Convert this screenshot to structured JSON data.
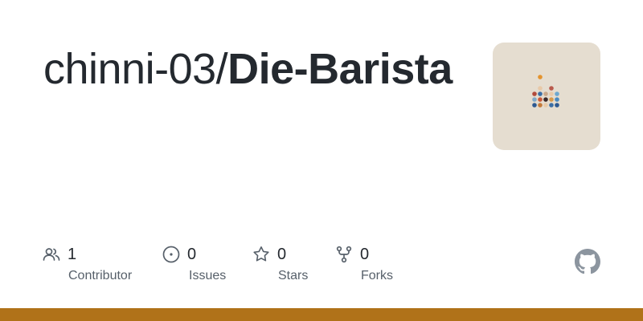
{
  "repo": {
    "owner": "chinni-03/",
    "name": "Die-Barista"
  },
  "stats": [
    {
      "value": "1",
      "label": "Contributor",
      "icon": "people-icon"
    },
    {
      "value": "0",
      "label": "Issues",
      "icon": "issue-opened-icon"
    },
    {
      "value": "0",
      "label": "Stars",
      "icon": "star-icon"
    },
    {
      "value": "0",
      "label": "Forks",
      "icon": "repo-forked-icon"
    }
  ],
  "colors": {
    "language_bar": "#b07219",
    "avatar_bg": "#e5ddd0",
    "text": "#24292f",
    "muted": "#57606a"
  }
}
